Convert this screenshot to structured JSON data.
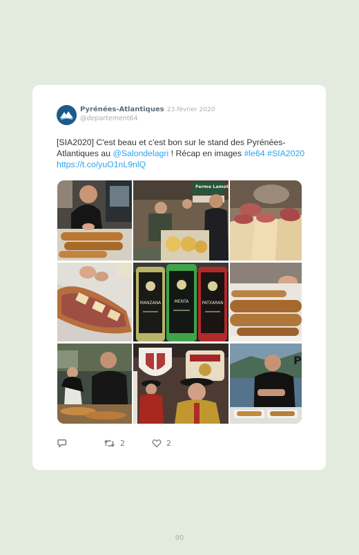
{
  "tweet": {
    "author_name": "Pyrénées-Atlantiques",
    "separator": "·",
    "date": "23 février 2020",
    "handle": "@departement64",
    "text_lead": "[SIA2020] C'est beau et c'est bon sur le stand des Pyrénées-Atlantiques au ",
    "mention": "@Salondelagri",
    "text_tail": " ! Récap en images ",
    "hashtag_1": "#le64",
    "hashtag_2": "#SIA2020",
    "link": "https://t.co/yuO1nL9nlQ",
    "photos": [
      {
        "name": "chef-slicing-bread-photo"
      },
      {
        "name": "cheese-stand-photo",
        "sign": "Ferme Lamothe"
      },
      {
        "name": "charcuterie-cones-photo"
      },
      {
        "name": "bread-with-cheese-photo"
      },
      {
        "name": "liqueur-bottles-photo",
        "labels": [
          "MANZANA",
          "MENTA",
          "PATXARAN"
        ]
      },
      {
        "name": "sausages-photo"
      },
      {
        "name": "cooking-demo-photo"
      },
      {
        "name": "confrerie-costumes-photo"
      },
      {
        "name": "chef-presenting-photo"
      }
    ],
    "retweet_count": "2",
    "like_count": "2",
    "icons": {
      "reply": "reply-icon",
      "retweet": "retweet-icon",
      "like": "heart-icon"
    }
  },
  "page": {
    "number": "90"
  },
  "colors": {
    "link": "#2aa3ef",
    "background": "#e3ebdf",
    "avatar": "#1b5b8c"
  }
}
